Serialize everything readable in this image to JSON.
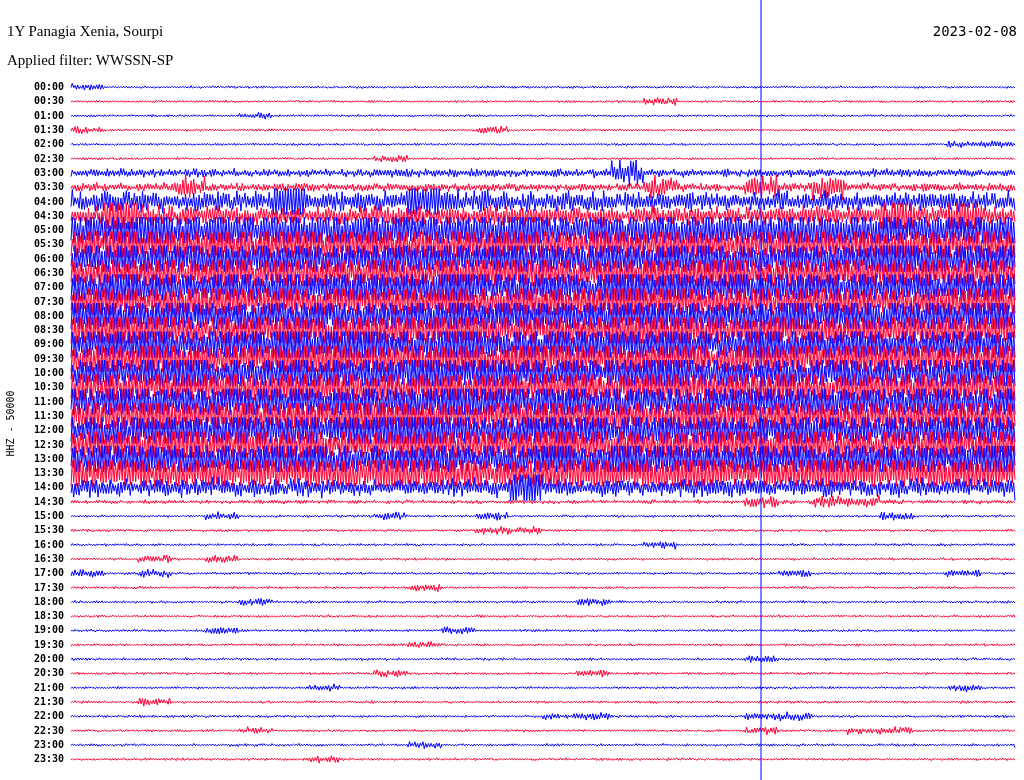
{
  "header": {
    "station": "1Y Panagia Xenia, Sourpi",
    "date": "2023-02-08",
    "filter": "Applied filter: WWSSN-SP"
  },
  "axis_label": "HHZ - 50000",
  "rows": [
    {
      "label": "00:00",
      "color": "#0000ff"
    },
    {
      "label": "00:30",
      "color": "#ff0033"
    },
    {
      "label": "01:00",
      "color": "#0000ff"
    },
    {
      "label": "01:30",
      "color": "#ff0033"
    },
    {
      "label": "02:00",
      "color": "#0000ff"
    },
    {
      "label": "02:30",
      "color": "#ff0033"
    },
    {
      "label": "03:00",
      "color": "#0000ff"
    },
    {
      "label": "03:30",
      "color": "#ff0033"
    },
    {
      "label": "04:00",
      "color": "#0000ff"
    },
    {
      "label": "04:30",
      "color": "#ff0033"
    },
    {
      "label": "05:00",
      "color": "#0000ff"
    },
    {
      "label": "05:30",
      "color": "#ff0033"
    },
    {
      "label": "06:00",
      "color": "#0000ff"
    },
    {
      "label": "06:30",
      "color": "#ff0033"
    },
    {
      "label": "07:00",
      "color": "#0000ff"
    },
    {
      "label": "07:30",
      "color": "#ff0033"
    },
    {
      "label": "08:00",
      "color": "#0000ff"
    },
    {
      "label": "08:30",
      "color": "#ff0033"
    },
    {
      "label": "09:00",
      "color": "#0000ff"
    },
    {
      "label": "09:30",
      "color": "#ff0033"
    },
    {
      "label": "10:00",
      "color": "#0000ff"
    },
    {
      "label": "10:30",
      "color": "#ff0033"
    },
    {
      "label": "11:00",
      "color": "#0000ff"
    },
    {
      "label": "11:30",
      "color": "#ff0033"
    },
    {
      "label": "12:00",
      "color": "#0000ff"
    },
    {
      "label": "12:30",
      "color": "#ff0033"
    },
    {
      "label": "13:00",
      "color": "#0000ff"
    },
    {
      "label": "13:30",
      "color": "#ff0033"
    },
    {
      "label": "14:00",
      "color": "#0000ff"
    },
    {
      "label": "14:30",
      "color": "#ff0033"
    },
    {
      "label": "15:00",
      "color": "#0000ff"
    },
    {
      "label": "15:30",
      "color": "#ff0033"
    },
    {
      "label": "16:00",
      "color": "#0000ff"
    },
    {
      "label": "16:30",
      "color": "#ff0033"
    },
    {
      "label": "17:00",
      "color": "#0000ff"
    },
    {
      "label": "17:30",
      "color": "#ff0033"
    },
    {
      "label": "18:00",
      "color": "#0000ff"
    },
    {
      "label": "18:30",
      "color": "#ff0033"
    },
    {
      "label": "19:00",
      "color": "#0000ff"
    },
    {
      "label": "19:30",
      "color": "#ff0033"
    },
    {
      "label": "20:00",
      "color": "#0000ff"
    },
    {
      "label": "20:30",
      "color": "#ff0033"
    },
    {
      "label": "21:00",
      "color": "#0000ff"
    },
    {
      "label": "21:30",
      "color": "#ff0033"
    },
    {
      "label": "22:00",
      "color": "#0000ff"
    },
    {
      "label": "22:30",
      "color": "#ff0033"
    },
    {
      "label": "23:00",
      "color": "#0000ff"
    },
    {
      "label": "23:30",
      "color": "#ff0033"
    }
  ]
}
